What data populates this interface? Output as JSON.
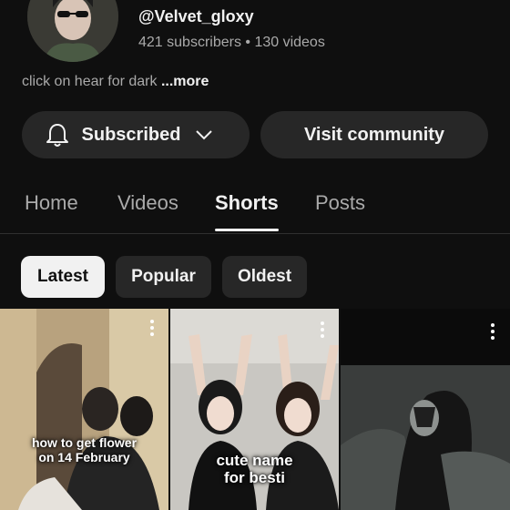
{
  "channel": {
    "handle": "@Velvet_gloxy",
    "meta": "421 subscribers • 130 videos",
    "bio": "click on hear for dark ",
    "bio_more": "...more"
  },
  "actions": {
    "subscribed_label": "Subscribed",
    "visit_label": "Visit community"
  },
  "tabs": [
    {
      "label": "Home",
      "active": false
    },
    {
      "label": "Videos",
      "active": false
    },
    {
      "label": "Shorts",
      "active": true
    },
    {
      "label": "Posts",
      "active": false
    }
  ],
  "filters": [
    {
      "label": "Latest",
      "selected": true
    },
    {
      "label": "Popular",
      "selected": false
    },
    {
      "label": "Oldest",
      "selected": false
    }
  ],
  "shorts": [
    {
      "caption_line1": "how to get flower",
      "caption_line2": "on 14 February"
    },
    {
      "caption_line1": "cute name",
      "caption_line2": "for besti"
    },
    {
      "caption_line1": "",
      "caption_line2": ""
    }
  ],
  "colors": {
    "background": "#0f0f0f",
    "button_bg": "#272727",
    "text_primary": "#f1f1f1",
    "text_secondary": "#aaaaaa"
  }
}
